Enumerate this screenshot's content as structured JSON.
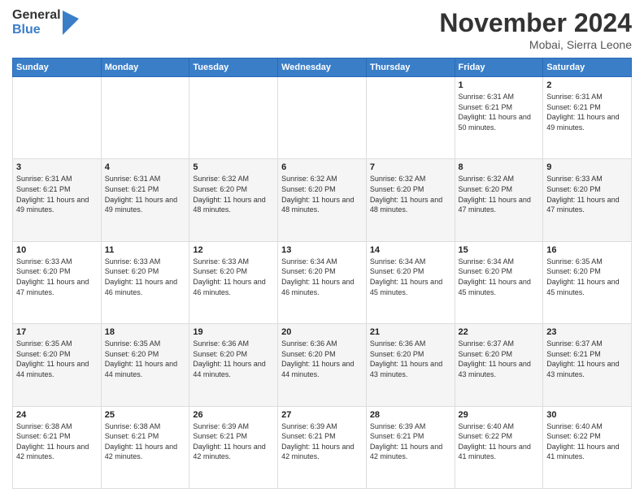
{
  "header": {
    "logo_general": "General",
    "logo_blue": "Blue",
    "month_title": "November 2024",
    "location": "Mobai, Sierra Leone"
  },
  "days_of_week": [
    "Sunday",
    "Monday",
    "Tuesday",
    "Wednesday",
    "Thursday",
    "Friday",
    "Saturday"
  ],
  "weeks": [
    [
      {
        "day": "",
        "info": ""
      },
      {
        "day": "",
        "info": ""
      },
      {
        "day": "",
        "info": ""
      },
      {
        "day": "",
        "info": ""
      },
      {
        "day": "",
        "info": ""
      },
      {
        "day": "1",
        "info": "Sunrise: 6:31 AM\nSunset: 6:21 PM\nDaylight: 11 hours\nand 50 minutes."
      },
      {
        "day": "2",
        "info": "Sunrise: 6:31 AM\nSunset: 6:21 PM\nDaylight: 11 hours\nand 49 minutes."
      }
    ],
    [
      {
        "day": "3",
        "info": "Sunrise: 6:31 AM\nSunset: 6:21 PM\nDaylight: 11 hours\nand 49 minutes."
      },
      {
        "day": "4",
        "info": "Sunrise: 6:31 AM\nSunset: 6:21 PM\nDaylight: 11 hours\nand 49 minutes."
      },
      {
        "day": "5",
        "info": "Sunrise: 6:32 AM\nSunset: 6:20 PM\nDaylight: 11 hours\nand 48 minutes."
      },
      {
        "day": "6",
        "info": "Sunrise: 6:32 AM\nSunset: 6:20 PM\nDaylight: 11 hours\nand 48 minutes."
      },
      {
        "day": "7",
        "info": "Sunrise: 6:32 AM\nSunset: 6:20 PM\nDaylight: 11 hours\nand 48 minutes."
      },
      {
        "day": "8",
        "info": "Sunrise: 6:32 AM\nSunset: 6:20 PM\nDaylight: 11 hours\nand 47 minutes."
      },
      {
        "day": "9",
        "info": "Sunrise: 6:33 AM\nSunset: 6:20 PM\nDaylight: 11 hours\nand 47 minutes."
      }
    ],
    [
      {
        "day": "10",
        "info": "Sunrise: 6:33 AM\nSunset: 6:20 PM\nDaylight: 11 hours\nand 47 minutes."
      },
      {
        "day": "11",
        "info": "Sunrise: 6:33 AM\nSunset: 6:20 PM\nDaylight: 11 hours\nand 46 minutes."
      },
      {
        "day": "12",
        "info": "Sunrise: 6:33 AM\nSunset: 6:20 PM\nDaylight: 11 hours\nand 46 minutes."
      },
      {
        "day": "13",
        "info": "Sunrise: 6:34 AM\nSunset: 6:20 PM\nDaylight: 11 hours\nand 46 minutes."
      },
      {
        "day": "14",
        "info": "Sunrise: 6:34 AM\nSunset: 6:20 PM\nDaylight: 11 hours\nand 45 minutes."
      },
      {
        "day": "15",
        "info": "Sunrise: 6:34 AM\nSunset: 6:20 PM\nDaylight: 11 hours\nand 45 minutes."
      },
      {
        "day": "16",
        "info": "Sunrise: 6:35 AM\nSunset: 6:20 PM\nDaylight: 11 hours\nand 45 minutes."
      }
    ],
    [
      {
        "day": "17",
        "info": "Sunrise: 6:35 AM\nSunset: 6:20 PM\nDaylight: 11 hours\nand 44 minutes."
      },
      {
        "day": "18",
        "info": "Sunrise: 6:35 AM\nSunset: 6:20 PM\nDaylight: 11 hours\nand 44 minutes."
      },
      {
        "day": "19",
        "info": "Sunrise: 6:36 AM\nSunset: 6:20 PM\nDaylight: 11 hours\nand 44 minutes."
      },
      {
        "day": "20",
        "info": "Sunrise: 6:36 AM\nSunset: 6:20 PM\nDaylight: 11 hours\nand 44 minutes."
      },
      {
        "day": "21",
        "info": "Sunrise: 6:36 AM\nSunset: 6:20 PM\nDaylight: 11 hours\nand 43 minutes."
      },
      {
        "day": "22",
        "info": "Sunrise: 6:37 AM\nSunset: 6:20 PM\nDaylight: 11 hours\nand 43 minutes."
      },
      {
        "day": "23",
        "info": "Sunrise: 6:37 AM\nSunset: 6:21 PM\nDaylight: 11 hours\nand 43 minutes."
      }
    ],
    [
      {
        "day": "24",
        "info": "Sunrise: 6:38 AM\nSunset: 6:21 PM\nDaylight: 11 hours\nand 42 minutes."
      },
      {
        "day": "25",
        "info": "Sunrise: 6:38 AM\nSunset: 6:21 PM\nDaylight: 11 hours\nand 42 minutes."
      },
      {
        "day": "26",
        "info": "Sunrise: 6:39 AM\nSunset: 6:21 PM\nDaylight: 11 hours\nand 42 minutes."
      },
      {
        "day": "27",
        "info": "Sunrise: 6:39 AM\nSunset: 6:21 PM\nDaylight: 11 hours\nand 42 minutes."
      },
      {
        "day": "28",
        "info": "Sunrise: 6:39 AM\nSunset: 6:21 PM\nDaylight: 11 hours\nand 42 minutes."
      },
      {
        "day": "29",
        "info": "Sunrise: 6:40 AM\nSunset: 6:22 PM\nDaylight: 11 hours\nand 41 minutes."
      },
      {
        "day": "30",
        "info": "Sunrise: 6:40 AM\nSunset: 6:22 PM\nDaylight: 11 hours\nand 41 minutes."
      }
    ]
  ]
}
